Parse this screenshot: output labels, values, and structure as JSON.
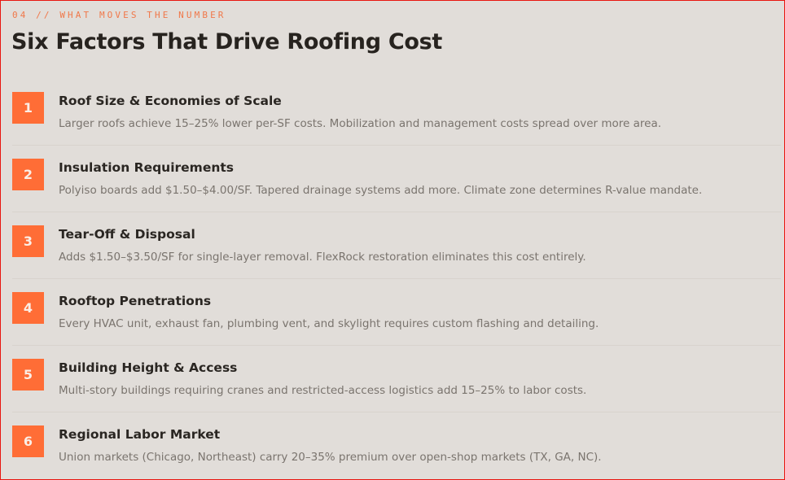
{
  "section": {
    "eyebrow": "04 // WHAT MOVES THE NUMBER",
    "title": "Six Factors That Drive Roofing Cost"
  },
  "colors": {
    "accent": "#ff6d36",
    "eyebrow": "#f0784a",
    "background": "#e1ddd9",
    "heading": "#27231f",
    "body_text": "#7a746e"
  },
  "factors": [
    {
      "number": "1",
      "title": "Roof Size & Economies of Scale",
      "description": "Larger roofs achieve 15–25% lower per-SF costs. Mobilization and management costs spread over more area."
    },
    {
      "number": "2",
      "title": "Insulation Requirements",
      "description": "Polyiso boards add $1.50–$4.00/SF. Tapered drainage systems add more. Climate zone determines R-value mandate."
    },
    {
      "number": "3",
      "title": "Tear-Off & Disposal",
      "description": "Adds $1.50–$3.50/SF for single-layer removal. FlexRock restoration eliminates this cost entirely."
    },
    {
      "number": "4",
      "title": "Rooftop Penetrations",
      "description": "Every HVAC unit, exhaust fan, plumbing vent, and skylight requires custom flashing and detailing."
    },
    {
      "number": "5",
      "title": "Building Height & Access",
      "description": "Multi-story buildings requiring cranes and restricted-access logistics add 15–25% to labor costs."
    },
    {
      "number": "6",
      "title": "Regional Labor Market",
      "description": "Union markets (Chicago, Northeast) carry 20–35% premium over open-shop markets (TX, GA, NC)."
    }
  ]
}
